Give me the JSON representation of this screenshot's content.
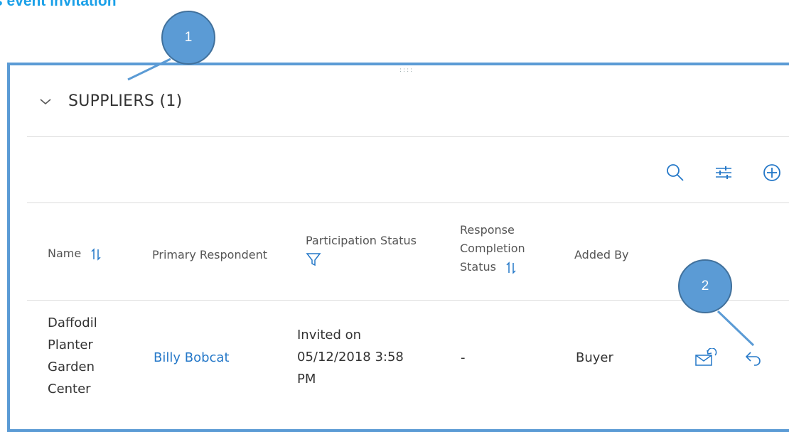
{
  "page": {
    "title": "s event invitation"
  },
  "callouts": [
    "1",
    "2"
  ],
  "section": {
    "title": "SUPPLIERS (1)"
  },
  "icons": {
    "collapse": "chevron-down-icon",
    "search": "search-icon",
    "filter_settings": "sliders-icon",
    "add": "add-circle-icon",
    "sort": "sort-icon",
    "filter": "funnel-icon",
    "resend": "envelope-refresh-icon",
    "reply": "reply-arrow-icon"
  },
  "table": {
    "columns": {
      "name": "Name",
      "primary_respondent": "Primary Respondent",
      "participation_status": "Participation Status",
      "response_completion_line1": "Response",
      "response_completion_line2": "Completion",
      "response_completion_line3": "Status",
      "added_by": "Added By"
    },
    "rows": [
      {
        "name_lines": [
          "Daffodil",
          "Planter",
          "Garden",
          "Center"
        ],
        "primary_respondent": "Billy Bobcat",
        "status_lines": [
          "Invited on",
          "05/12/2018 3:58",
          "PM"
        ],
        "response_completion": "-",
        "added_by": "Buyer"
      }
    ]
  },
  "colors": {
    "accent": "#2578c8",
    "title": "#1aa0e8",
    "callout": "#5b9bd5"
  }
}
